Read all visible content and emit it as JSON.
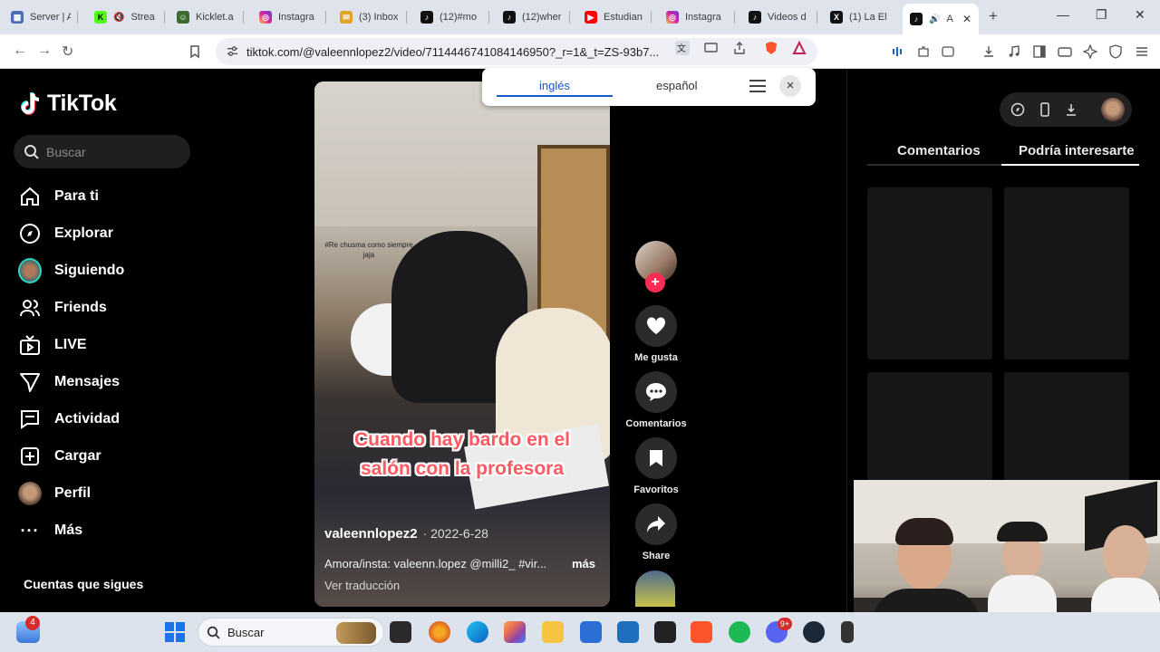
{
  "browser": {
    "tabs": [
      {
        "title": "Server | A",
        "favicon": "server-icon",
        "color": "#4a6fb5"
      },
      {
        "title": "Strea",
        "favicon": "kick-icon",
        "color": "#53fc18"
      },
      {
        "title": "Kicklet.a",
        "favicon": "kicklet-icon",
        "color": "#3b6b2f"
      },
      {
        "title": "Instagra",
        "favicon": "instagram-icon",
        "color": "#d6249f"
      },
      {
        "title": "(3) Inbox",
        "favicon": "inbox-icon",
        "color": "#e0a526"
      },
      {
        "title": "(12)#mo",
        "favicon": "tiktok-icon",
        "color": "#111111"
      },
      {
        "title": "(12)wher",
        "favicon": "tiktok-icon",
        "color": "#111111"
      },
      {
        "title": "Estudian",
        "favicon": "youtube-icon",
        "color": "#ff0000"
      },
      {
        "title": "Instagra",
        "favicon": "instagram-icon",
        "color": "#d6249f"
      },
      {
        "title": "Videos d",
        "favicon": "tiktok-icon",
        "color": "#111111"
      },
      {
        "title": "(1) La El",
        "favicon": "x-icon",
        "color": "#111111"
      },
      {
        "title": "A",
        "favicon": "tiktok-icon",
        "color": "#111111"
      }
    ],
    "new_tab": "+",
    "url": "tiktok.com/@valeennlopez2/video/7114446741084146950?_r=1&_t=ZS-93b7..."
  },
  "translate_popup": {
    "source_lang": "inglés",
    "target_lang": "español",
    "close": "×"
  },
  "tiktok": {
    "logo": "TikTok",
    "search_placeholder": "Buscar",
    "nav": [
      {
        "label": "Para ti",
        "icon": "home-icon"
      },
      {
        "label": "Explorar",
        "icon": "compass-icon"
      },
      {
        "label": "Siguiendo",
        "icon": "avatar-icon"
      },
      {
        "label": "Friends",
        "icon": "friends-icon"
      },
      {
        "label": "LIVE",
        "icon": "live-icon"
      },
      {
        "label": "Mensajes",
        "icon": "send-icon"
      },
      {
        "label": "Actividad",
        "icon": "activity-icon"
      },
      {
        "label": "Cargar",
        "icon": "upload-icon"
      },
      {
        "label": "Perfil",
        "icon": "profile-avatar-icon"
      },
      {
        "label": "Más",
        "icon": "more-dots-icon"
      }
    ],
    "following_title": "Cuentas que sigues",
    "video": {
      "overlay_tag": "#Re chusma como siempre jaja",
      "caption_line1": "Cuando hay bardo en el",
      "caption_line2": "salón con la profesora",
      "author": "valeennlopez2",
      "date": "· 2022-6-28",
      "description": "Amora/insta: valeenn.lopez @milli2_ #vir...",
      "more": "más",
      "see_translation": "Ver traducción"
    },
    "actions": [
      {
        "label": "Me gusta",
        "icon": "heart-icon"
      },
      {
        "label": "Comentarios",
        "icon": "comment-icon"
      },
      {
        "label": "Favoritos",
        "icon": "bookmark-icon"
      },
      {
        "label": "Share",
        "icon": "share-icon"
      }
    ],
    "right_tabs": {
      "comments": "Comentarios",
      "suggested": "Podría interesarte"
    }
  },
  "taskbar": {
    "search_placeholder": "Buscar",
    "notification_badge": "4",
    "discord_badge": "9+"
  }
}
